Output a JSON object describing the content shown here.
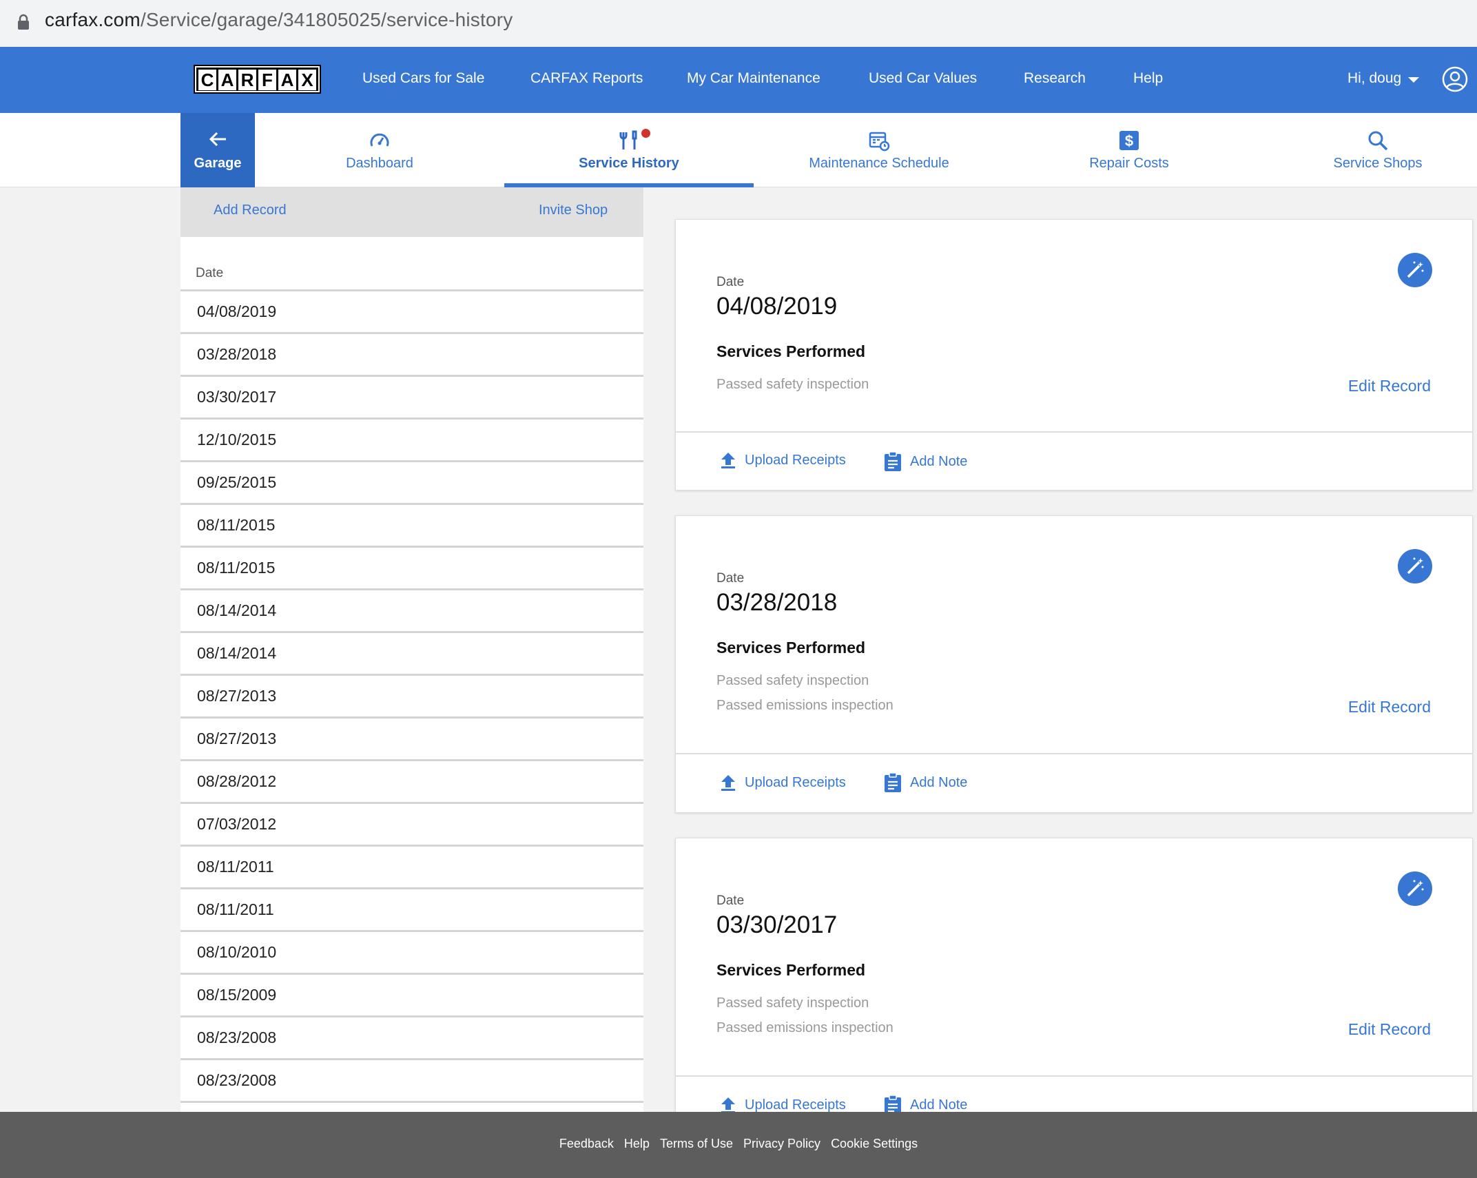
{
  "browser": {
    "url_domain": "carfax.com",
    "url_path": "/Service/garage/341805025/service-history"
  },
  "topnav": {
    "logo_letters": [
      "C",
      "A",
      "R",
      "F",
      "A",
      "X"
    ],
    "items": [
      "Used Cars for Sale",
      "CARFAX Reports",
      "My Car Maintenance",
      "Used Car Values",
      "Research",
      "Help"
    ],
    "user_greeting": "Hi, doug"
  },
  "subnav": {
    "garage_label": "Garage",
    "tabs": [
      "Dashboard",
      "Service History",
      "Maintenance Schedule",
      "Repair Costs",
      "Service Shops"
    ],
    "active_tab": "Service History",
    "notification_color": "#d0322e"
  },
  "left_panel": {
    "add_record": "Add Record",
    "invite_shop": "Invite Shop",
    "date_header": "Date",
    "dates": [
      "04/08/2019",
      "03/28/2018",
      "03/30/2017",
      "12/10/2015",
      "09/25/2015",
      "08/11/2015",
      "08/11/2015",
      "08/14/2014",
      "08/14/2014",
      "08/27/2013",
      "08/27/2013",
      "08/28/2012",
      "07/03/2012",
      "08/11/2011",
      "08/11/2011",
      "08/10/2010",
      "08/15/2009",
      "08/23/2008",
      "08/23/2008"
    ]
  },
  "records": [
    {
      "date_label": "Date",
      "date": "04/08/2019",
      "services_label": "Services Performed",
      "services": [
        "Passed safety inspection"
      ],
      "edit_label": "Edit Record",
      "upload_label": "Upload Receipts",
      "note_label": "Add Note"
    },
    {
      "date_label": "Date",
      "date": "03/28/2018",
      "services_label": "Services Performed",
      "services": [
        "Passed safety inspection",
        "Passed emissions inspection"
      ],
      "edit_label": "Edit Record",
      "upload_label": "Upload Receipts",
      "note_label": "Add Note"
    },
    {
      "date_label": "Date",
      "date": "03/30/2017",
      "services_label": "Services Performed",
      "services": [
        "Passed safety inspection",
        "Passed emissions inspection"
      ],
      "edit_label": "Edit Record",
      "upload_label": "Upload Receipts",
      "note_label": "Add Note"
    }
  ],
  "footer": {
    "links": [
      "Feedback",
      "Help",
      "Terms of Use",
      "Privacy Policy",
      "Cookie Settings"
    ]
  },
  "colors": {
    "brand_blue": "#3777d3",
    "garage_blue": "#2d69c0",
    "footer_gray": "#5d5d5d"
  }
}
